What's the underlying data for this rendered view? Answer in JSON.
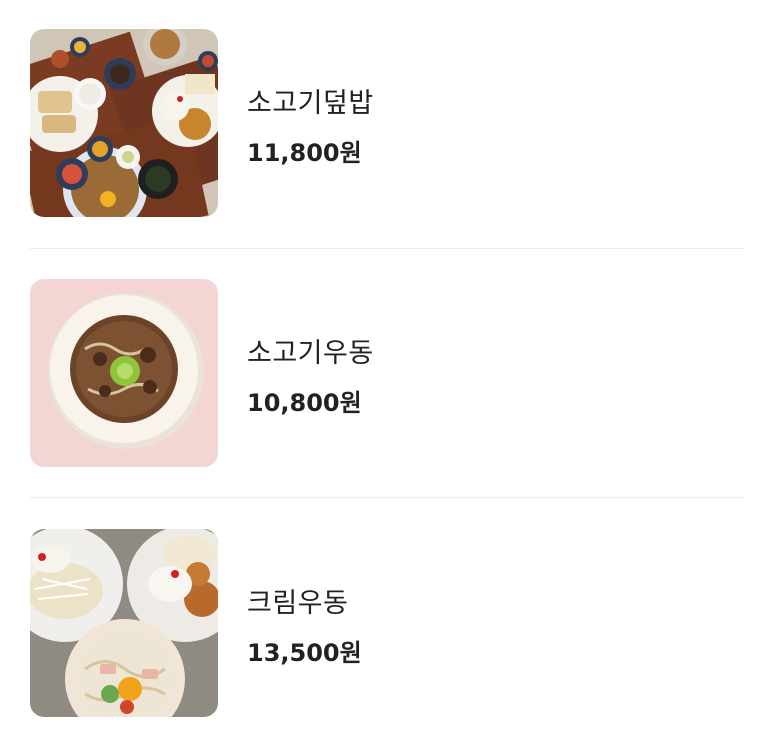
{
  "menu": {
    "items": [
      {
        "name": "소고기덮밥",
        "price": "11,800원",
        "photo_icon": "set-meal-photo"
      },
      {
        "name": "소고기우동",
        "price": "10,800원",
        "photo_icon": "udon-bowl-photo"
      },
      {
        "name": "크림우동",
        "price": "13,500원",
        "photo_icon": "cream-udon-photo"
      }
    ]
  },
  "colors": {
    "text": "#222222",
    "divider": "#ececec",
    "thumb2_background": "#f3d6d3",
    "tray_wood": "#7a3b22"
  }
}
